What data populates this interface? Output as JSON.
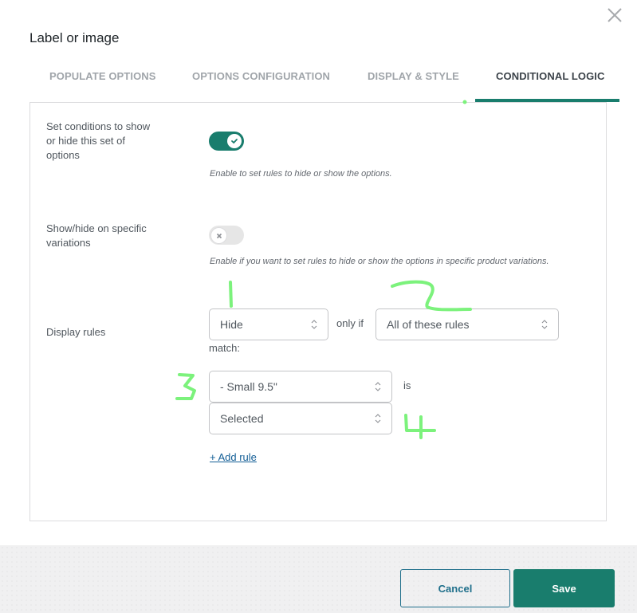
{
  "modal": {
    "title": "Label or image",
    "close_icon": "close-icon"
  },
  "tabs": [
    {
      "label": "POPULATE OPTIONS",
      "active": false
    },
    {
      "label": "OPTIONS CONFIGURATION",
      "active": false
    },
    {
      "label": "DISPLAY & STYLE",
      "active": false
    },
    {
      "label": "CONDITIONAL LOGIC",
      "active": true
    }
  ],
  "fields": {
    "set_conditions": {
      "label": "Set conditions to show or hide this set of options",
      "toggle_on": true,
      "help": "Enable to set rules to hide or show the options."
    },
    "variations": {
      "label": "Show/hide on specific variations",
      "toggle_on": false,
      "help": "Enable if you want to set rules to hide or show the options in specific product variations."
    },
    "display_rules": {
      "label": "Display rules",
      "action_select": "Hide",
      "only_if_text": "only if",
      "match_select": "All of these rules",
      "match_text": "match:",
      "rule": {
        "option_select": "- Small 9.5\"",
        "is_text": "is",
        "state_select": "Selected"
      },
      "add_rule_link": "+ Add rule"
    }
  },
  "footer": {
    "cancel_label": "Cancel",
    "save_label": "Save"
  },
  "annotations": {
    "color": "#7cf27c",
    "labels": [
      "1",
      "2",
      "3",
      "4"
    ]
  },
  "colors": {
    "accent": "#197d6d",
    "link": "#135e96"
  }
}
